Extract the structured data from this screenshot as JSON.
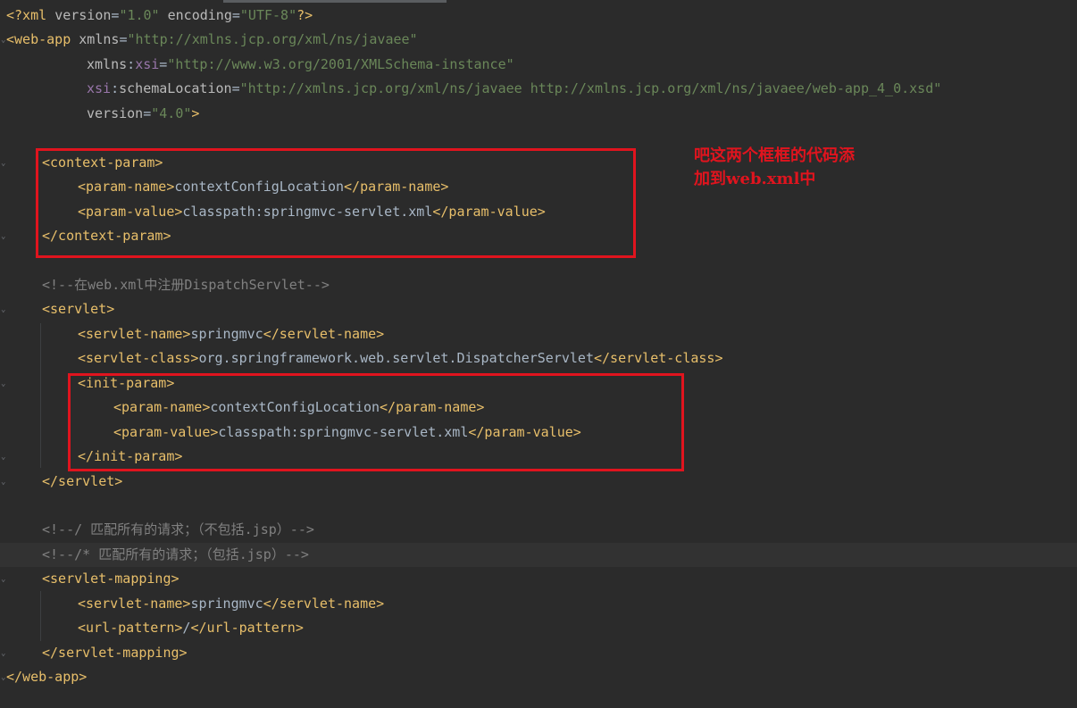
{
  "editor": {
    "lines": [
      {
        "i": 0,
        "segs": [
          {
            "c": "t",
            "s": "<?xml "
          },
          {
            "c": "a",
            "s": "version"
          },
          {
            "c": "x",
            "s": "="
          },
          {
            "c": "v",
            "s": "\"1.0\""
          },
          {
            "c": "a",
            "s": " encoding"
          },
          {
            "c": "x",
            "s": "="
          },
          {
            "c": "v",
            "s": "\"UTF-8\""
          },
          {
            "c": "t",
            "s": "?>"
          }
        ]
      },
      {
        "i": 0,
        "segs": [
          {
            "c": "t",
            "s": "<web-app "
          },
          {
            "c": "a",
            "s": "xmlns"
          },
          {
            "c": "x",
            "s": "="
          },
          {
            "c": "v",
            "s": "\"http://xmlns.jcp.org/xml/ns/javaee\""
          }
        ]
      },
      {
        "i": 90,
        "segs": [
          {
            "c": "a",
            "s": "xmlns"
          },
          {
            "c": "x",
            "s": ":"
          },
          {
            "c": "ns",
            "s": "xsi"
          },
          {
            "c": "x",
            "s": "="
          },
          {
            "c": "v",
            "s": "\"http://www.w3.org/2001/XMLSchema-instance\""
          }
        ]
      },
      {
        "i": 90,
        "segs": [
          {
            "c": "ns",
            "s": "xsi"
          },
          {
            "c": "x",
            "s": ":"
          },
          {
            "c": "a",
            "s": "schemaLocation"
          },
          {
            "c": "x",
            "s": "="
          },
          {
            "c": "v",
            "s": "\"http://xmlns.jcp.org/xml/ns/javaee http://xmlns.jcp.org/xml/ns/javaee/web-app_4_0.xsd\""
          }
        ]
      },
      {
        "i": 90,
        "segs": [
          {
            "c": "a",
            "s": "version"
          },
          {
            "c": "x",
            "s": "="
          },
          {
            "c": "v",
            "s": "\"4.0\""
          },
          {
            "c": "t",
            "s": ">"
          }
        ]
      },
      {
        "i": 0,
        "segs": []
      },
      {
        "i": 40,
        "segs": [
          {
            "c": "t",
            "s": "<context-param>"
          }
        ]
      },
      {
        "i": 80,
        "segs": [
          {
            "c": "t",
            "s": "<param-name>"
          },
          {
            "c": "x",
            "s": "contextConfigLocation"
          },
          {
            "c": "t",
            "s": "</param-name>"
          }
        ]
      },
      {
        "i": 80,
        "segs": [
          {
            "c": "t",
            "s": "<param-value>"
          },
          {
            "c": "x",
            "s": "classpath:springmvc-servlet.xml"
          },
          {
            "c": "t",
            "s": "</param-value>"
          }
        ]
      },
      {
        "i": 40,
        "segs": [
          {
            "c": "t",
            "s": "</context-param>"
          }
        ]
      },
      {
        "i": 0,
        "segs": []
      },
      {
        "i": 40,
        "segs": [
          {
            "c": "c",
            "s": "<!--在web.xml中注册DispatchServlet-->"
          }
        ]
      },
      {
        "i": 40,
        "segs": [
          {
            "c": "t",
            "s": "<servlet>"
          }
        ]
      },
      {
        "i": 80,
        "segs": [
          {
            "c": "t",
            "s": "<servlet-name>"
          },
          {
            "c": "x",
            "s": "springmvc"
          },
          {
            "c": "t",
            "s": "</servlet-name>"
          }
        ]
      },
      {
        "i": 80,
        "segs": [
          {
            "c": "t",
            "s": "<servlet-class>"
          },
          {
            "c": "x",
            "s": "org.springframework.web.servlet.DispatcherServlet"
          },
          {
            "c": "t",
            "s": "</servlet-class>"
          }
        ]
      },
      {
        "i": 80,
        "segs": [
          {
            "c": "t",
            "s": "<init-param>"
          }
        ]
      },
      {
        "i": 120,
        "segs": [
          {
            "c": "t",
            "s": "<param-name>"
          },
          {
            "c": "x",
            "s": "contextConfigLocation"
          },
          {
            "c": "t",
            "s": "</param-name>"
          }
        ]
      },
      {
        "i": 120,
        "segs": [
          {
            "c": "t",
            "s": "<param-value>"
          },
          {
            "c": "x",
            "s": "classpath:springmvc-servlet.xml"
          },
          {
            "c": "t",
            "s": "</param-value>"
          }
        ]
      },
      {
        "i": 80,
        "segs": [
          {
            "c": "t",
            "s": "</init-param>"
          }
        ]
      },
      {
        "i": 40,
        "segs": [
          {
            "c": "t",
            "s": "</servlet>"
          }
        ]
      },
      {
        "i": 0,
        "segs": []
      },
      {
        "i": 40,
        "segs": [
          {
            "c": "c",
            "s": "<!--/ 匹配所有的请求；（不包括.jsp）-->"
          }
        ]
      },
      {
        "i": 40,
        "segs": [
          {
            "c": "c",
            "s": "<!--/* 匹配所有的请求；（包括.jsp）-->"
          }
        ]
      },
      {
        "i": 40,
        "segs": [
          {
            "c": "t",
            "s": "<servlet-mapping>"
          }
        ]
      },
      {
        "i": 80,
        "segs": [
          {
            "c": "t",
            "s": "<servlet-name>"
          },
          {
            "c": "x",
            "s": "springmvc"
          },
          {
            "c": "t",
            "s": "</servlet-name>"
          }
        ]
      },
      {
        "i": 80,
        "segs": [
          {
            "c": "t",
            "s": "<url-pattern>"
          },
          {
            "c": "x",
            "s": "/"
          },
          {
            "c": "t",
            "s": "</url-pattern>"
          }
        ]
      },
      {
        "i": 40,
        "segs": [
          {
            "c": "t",
            "s": "</servlet-mapping>"
          }
        ]
      },
      {
        "i": 0,
        "segs": [
          {
            "c": "t",
            "s": "</web-app>"
          }
        ]
      }
    ]
  },
  "annotation": {
    "line1": "吧这两个框框的代码添",
    "line2": "加到web.xml中"
  },
  "colors": {
    "background": "#2b2b2b",
    "tag": "#e8bf6a",
    "attribute": "#bababa",
    "namespace": "#9876aa",
    "value": "#6a8759",
    "comment": "#808080",
    "text": "#a9b7c6",
    "highlight_box": "#e0141e"
  }
}
